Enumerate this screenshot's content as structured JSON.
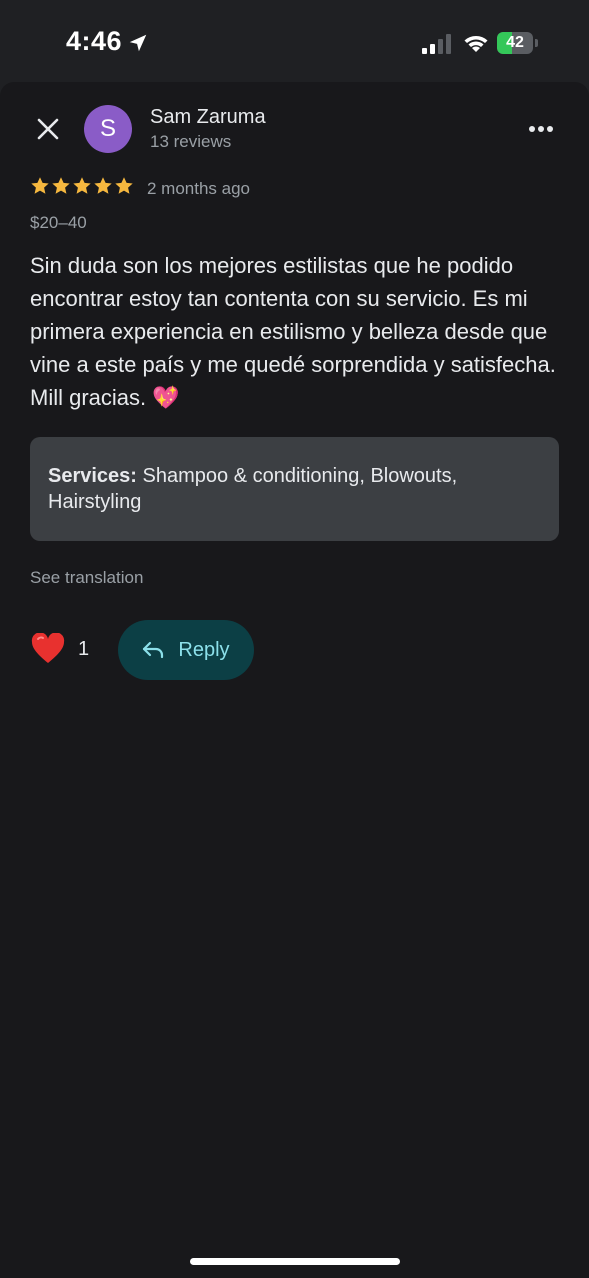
{
  "status_bar": {
    "time": "4:46",
    "battery_level": "42",
    "battery_fraction": 0.42
  },
  "review": {
    "reviewer_name": "Sam Zaruma",
    "reviewer_review_count": "13 reviews",
    "avatar_initial": "S",
    "rating": 5,
    "time_ago": "2 months ago",
    "price_range": "$20–40",
    "text": "Sin duda son los mejores estilistas que he podido encontrar estoy tan contenta con su servicio. Es mi primera experiencia en estilismo y belleza desde que vine a este país y me quedé sorprendida y satisfecha. Mill gracias. 💖",
    "services_label": "Services:",
    "services_value": " Shampoo & conditioning, Blowouts, Hairstyling",
    "see_translation": "See translation",
    "like_count": "1",
    "reply_label": "Reply"
  },
  "icons": {
    "close": "close-icon",
    "more": "more-vertical-icon",
    "star": "star-icon",
    "heart": "heart-icon",
    "reply": "reply-icon",
    "location": "location-arrow-icon",
    "signal": "cellular-signal-icon",
    "wifi": "wifi-icon",
    "battery": "battery-icon"
  },
  "colors": {
    "background": "#18181b",
    "avatar": "#8a5cc7",
    "star": "#f6b83f",
    "reply_button": "#0c3f45",
    "reply_text": "#8ce0ea",
    "services_box": "#3c3f43",
    "battery_fill": "#34c759"
  }
}
